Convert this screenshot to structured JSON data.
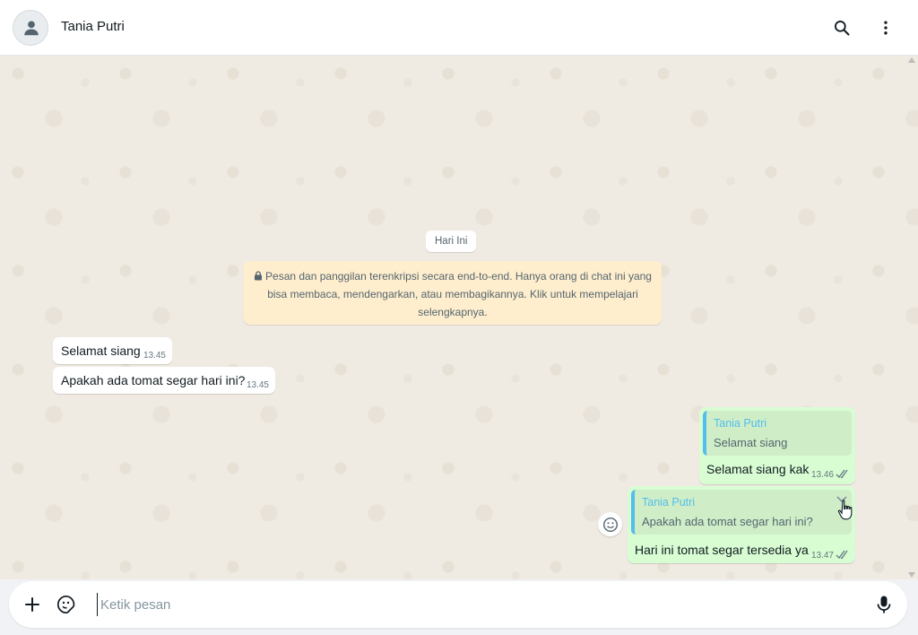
{
  "header": {
    "contact_name": "Tania Putri",
    "avatar_icon": "person-icon",
    "search_icon": "search-icon",
    "menu_icon": "more-vertical-icon"
  },
  "chat": {
    "date_chip": "Hari Ini",
    "encryption_notice": "Pesan dan panggilan terenkripsi secara end-to-end. Hanya orang di chat ini yang bisa membaca, mendengarkan, atau membagikannya. Klik untuk mempelajari selengkapnya.",
    "incoming": [
      {
        "text": "Selamat siang",
        "time": "13.45"
      },
      {
        "text": "Apakah ada tomat segar hari ini?",
        "time": "13.45"
      }
    ],
    "outgoing": [
      {
        "quote_name": "Tania Putri",
        "quote_text": "Selamat siang",
        "text": "Selamat siang kak",
        "time": "13.46",
        "status": "read"
      },
      {
        "quote_name": "Tania Putri",
        "quote_text": "Apakah ada tomat segar hari ini?",
        "text": "Hari ini tomat segar tersedia ya",
        "time": "13.47",
        "status": "read"
      }
    ]
  },
  "composer": {
    "placeholder": "Ketik pesan",
    "value": "",
    "attach_icon": "plus-icon",
    "sticker_icon": "sticker-icon",
    "mic_icon": "microphone-icon"
  },
  "colors": {
    "chat_bg": "#efeae2",
    "outgoing_bubble": "#d9fdd3",
    "quote_accent": "#53bdeb",
    "notice_bg": "#ffeecd"
  }
}
